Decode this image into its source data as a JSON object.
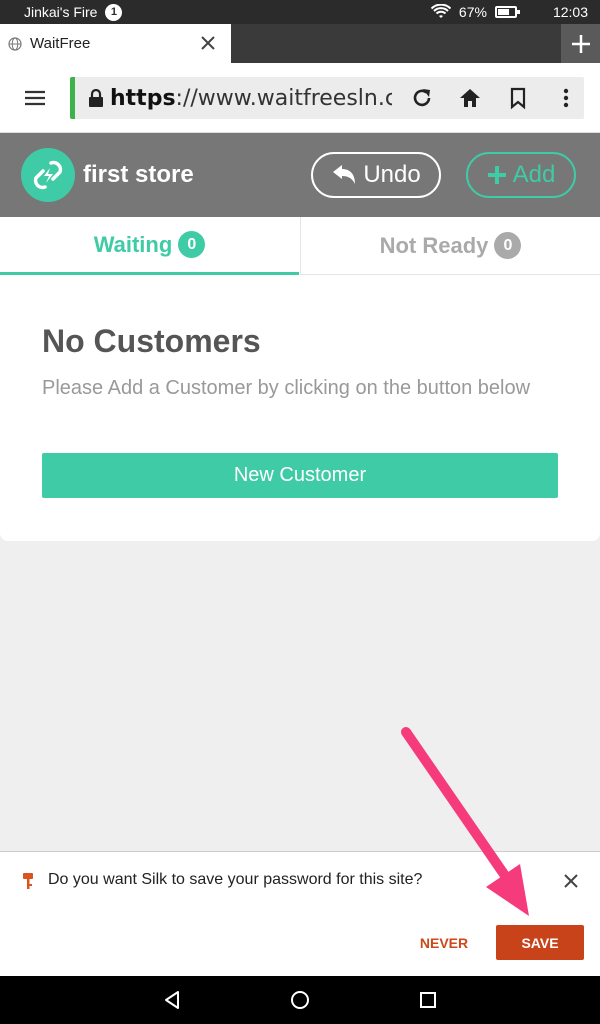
{
  "status_bar": {
    "title": "Jinkai's Fire",
    "notification_count": "1",
    "battery": "67%",
    "battery_level": 0.67,
    "time": "12:03"
  },
  "browser": {
    "tab_title": "WaitFree",
    "url_scheme": "https",
    "url_rest": "://www.waitfreesln.com"
  },
  "app": {
    "store_name": "first store",
    "undo_label": "Undo",
    "add_label": "Add",
    "tabs": [
      {
        "label": "Waiting",
        "count": "0",
        "active": true
      },
      {
        "label": "Not Ready",
        "count": "0",
        "active": false
      }
    ],
    "empty_title": "No Customers",
    "empty_text": "Please Add a Customer by clicking on the button below",
    "new_customer_label": "New Customer"
  },
  "password_prompt": {
    "message": "Do you want Silk to save your password for this site?",
    "never_label": "NEVER",
    "save_label": "SAVE"
  },
  "colors": {
    "accent": "#3ecba6",
    "header_bg": "#777777",
    "save_button": "#c9431a",
    "annotation_arrow": "#f53b7c"
  }
}
